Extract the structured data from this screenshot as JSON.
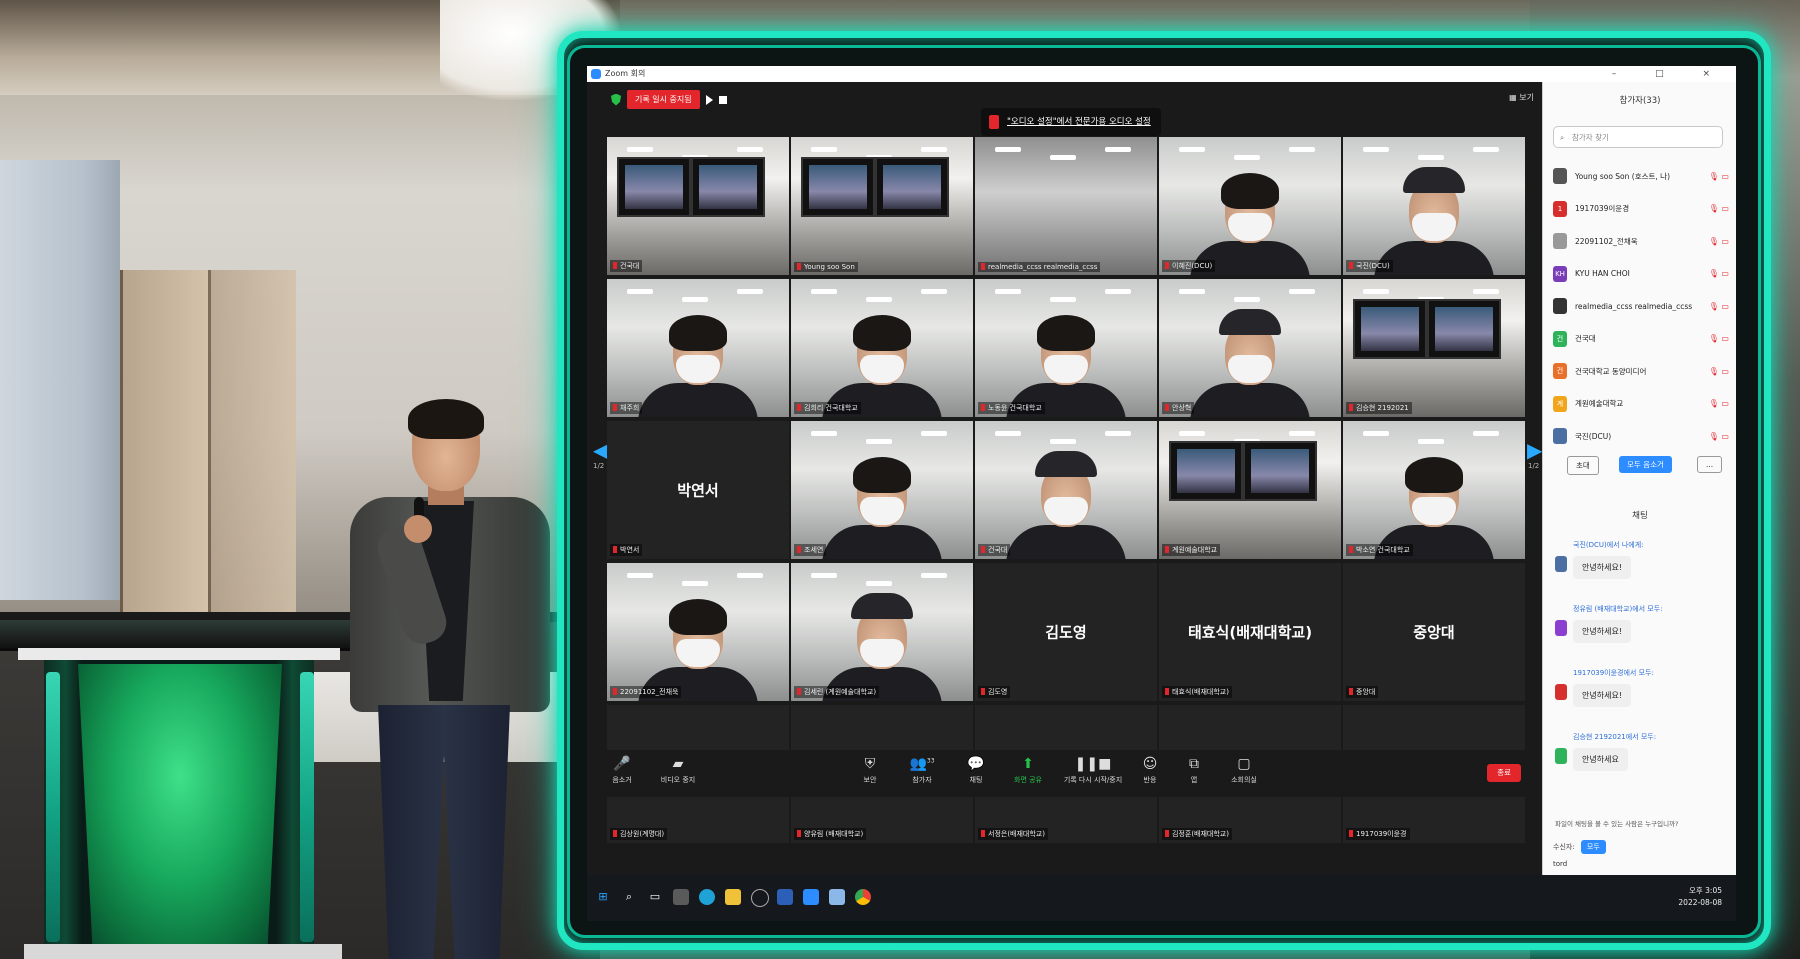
{
  "window": {
    "title": "Zoom 회의",
    "controls": [
      "–",
      "□",
      "×"
    ]
  },
  "meeting": {
    "recording_label": "기록 일시 중지됨",
    "audio_notice": "\"오디오 설정\"에서 전문가용 오디오 설정",
    "view_label": "보기",
    "page_indicator_left": "1/2",
    "page_indicator_right": "1/2"
  },
  "tiles": [
    {
      "name": "건국대",
      "kind": "room"
    },
    {
      "name": "Young soo Son",
      "kind": "screen",
      "speaker": true
    },
    {
      "name": "realmedia_ccss realmedia_ccss",
      "kind": "dark"
    },
    {
      "name": "이혜진(DCU)",
      "kind": "person"
    },
    {
      "name": "국진(DCU)",
      "kind": "person"
    },
    {
      "name": "채주희",
      "kind": "person"
    },
    {
      "name": "김희리 건국대학교",
      "kind": "person"
    },
    {
      "name": "노동윤 건국대학교",
      "kind": "person"
    },
    {
      "name": "안상혁",
      "kind": "person"
    },
    {
      "name": "김승현 2192021",
      "kind": "room"
    },
    {
      "name": "박연서",
      "label": "박연서",
      "kind": "blank"
    },
    {
      "name": "조세연",
      "kind": "person"
    },
    {
      "name": "건국대",
      "kind": "person"
    },
    {
      "name": "계원예술대학교",
      "kind": "room"
    },
    {
      "name": "박소연 건국대학교",
      "kind": "person"
    },
    {
      "name": "22091102_전채욱",
      "kind": "person"
    },
    {
      "name": "김세린 (계원예술대학교)",
      "kind": "person"
    },
    {
      "name": "김도영",
      "label": "김도영",
      "kind": "blank"
    },
    {
      "name": "태효식(배재대학교)",
      "label": "태효식(배재대학교)",
      "kind": "blank"
    },
    {
      "name": "중앙대",
      "label": "중앙대",
      "kind": "blank"
    },
    {
      "name": "김상원(계명대)",
      "label": "김상원(계명대)",
      "kind": "blank"
    },
    {
      "name": "양유림 (배재대학교)",
      "label": "양유림 (배재대학...",
      "kind": "blank"
    },
    {
      "name": "서정은(배재대학교)",
      "label": "서정은(배재대학교)",
      "kind": "blank"
    },
    {
      "name": "김정훈(배재대학교)",
      "label": "김정훈(배재대학교)",
      "kind": "blank"
    },
    {
      "name": "1917039이윤경",
      "label": "1917039이윤경",
      "kind": "blank"
    }
  ],
  "toolbar": {
    "mute": "음소거",
    "video": "비디오 중지",
    "security": "보안",
    "participants": "참가자",
    "participants_count": "33",
    "chat": "채팅",
    "share": "화면 공유",
    "record": "기록 다시 시작/중지",
    "reactions": "반응",
    "apps": "앱",
    "breakout": "소회의실",
    "end": "종료"
  },
  "taskbar": {
    "time": "오후 3:05",
    "date": "2022-08-08",
    "icons": [
      "start-icon",
      "search-icon",
      "task-view-icon",
      "store-icon",
      "edge-icon",
      "explorer-icon",
      "app-icon",
      "word-icon",
      "zoom-icon",
      "notes-icon",
      "chrome-icon"
    ]
  },
  "panel": {
    "participants_title": "참가자(33)",
    "search_placeholder": "참가자 찾기",
    "participants": [
      {
        "name": "Young soo Son (호스트, 나)",
        "color": "#555555",
        "initial": ""
      },
      {
        "name": "1917039이윤경",
        "color": "#d62d2d",
        "initial": "1"
      },
      {
        "name": "22091102_전채욱",
        "color": "#999999",
        "initial": ""
      },
      {
        "name": "KYU HAN CHOI",
        "color": "#7a3db8",
        "initial": "KH"
      },
      {
        "name": "realmedia_ccss realmedia_ccss",
        "color": "#333333",
        "initial": ""
      },
      {
        "name": "건국대",
        "color": "#2fb35a",
        "initial": "건"
      },
      {
        "name": "건국대학교 동양미디어",
        "color": "#e8702a",
        "initial": "건"
      },
      {
        "name": "계원예술대학교",
        "color": "#f0a51a",
        "initial": "계"
      },
      {
        "name": "국진(DCU)",
        "color": "#4b6fa3",
        "initial": ""
      }
    ],
    "invite_button": "초대",
    "mute_all_button": "모두 음소거",
    "more_button": "...",
    "chat_title": "채팅",
    "messages": [
      {
        "from": "국진(DCU)에서 나에게:",
        "text": "안녕하세요!",
        "color": "#4b6fa3"
      },
      {
        "from": "정유림 (배재대학교)에서 모두:",
        "text": "안녕하세요!",
        "color": "#8a3fd1"
      },
      {
        "from": "1917039이윤경에서 모두:",
        "text": "안녕하세요!",
        "color": "#d62d2d"
      },
      {
        "from": "김승현 2192021에서 모두:",
        "text": "안녕하세요",
        "color": "#2fb35a"
      }
    ],
    "chat_note": "파일이 채팅을 볼 수 있는 사람은 누구입니까?",
    "recipient_label": "수신자:",
    "recipient_value": "모두",
    "input_value": "tord"
  }
}
